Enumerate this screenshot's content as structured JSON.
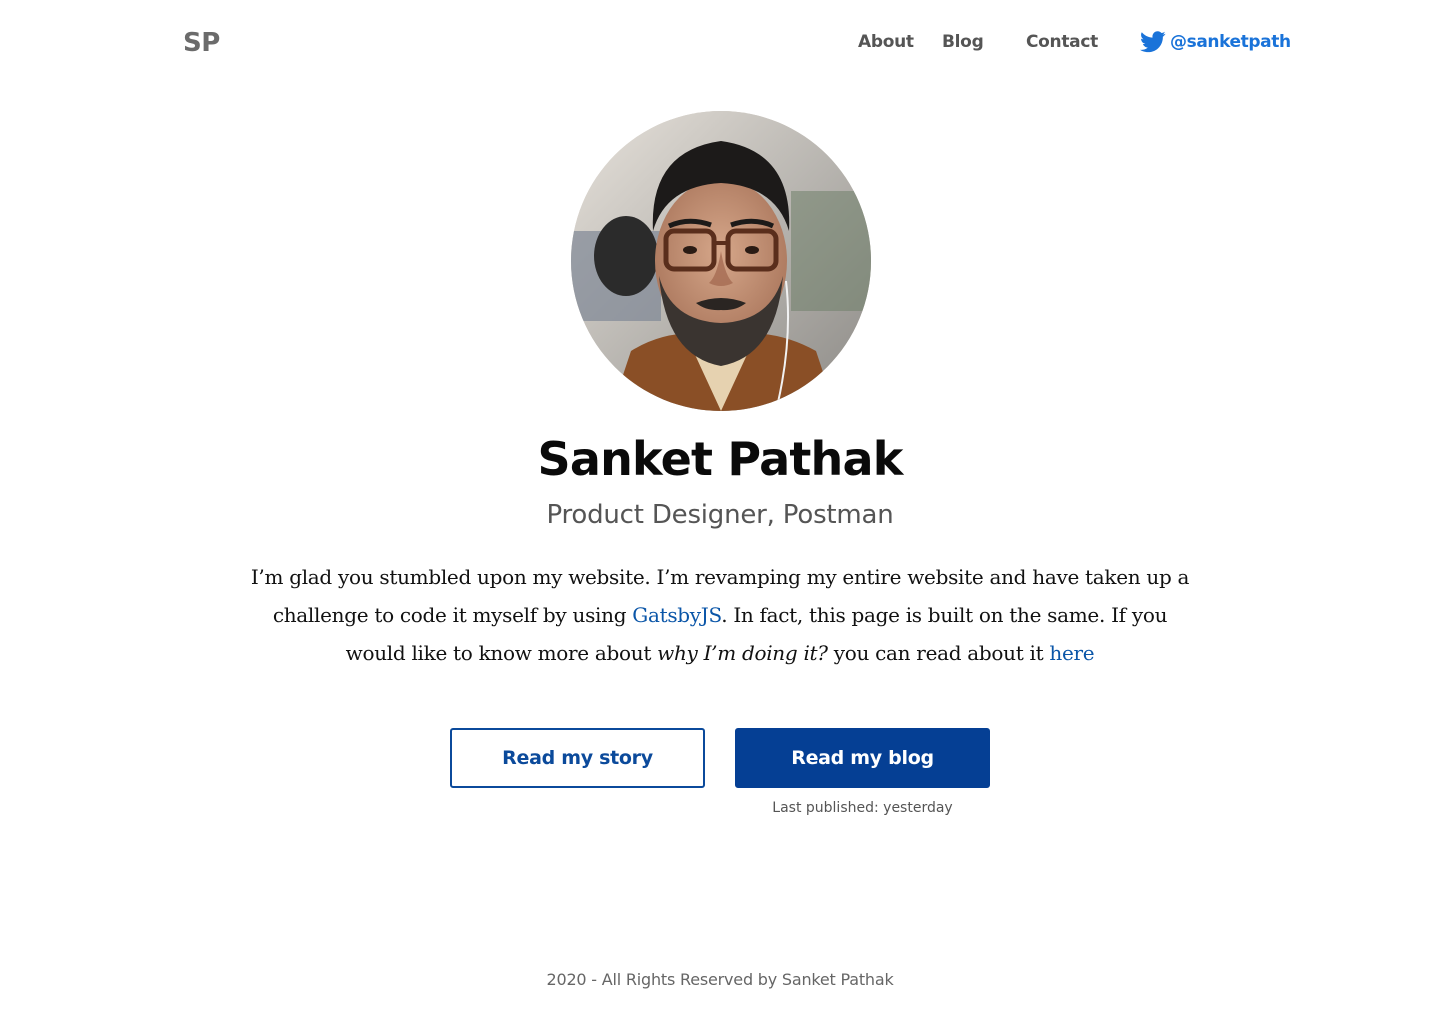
{
  "header": {
    "logo": "SP",
    "nav": [
      {
        "label": "About"
      },
      {
        "label": "Blog"
      },
      {
        "label": "Contact"
      }
    ],
    "twitter": {
      "icon": "twitter-icon",
      "handle": "@sanketpath",
      "color": "#1a73d9"
    }
  },
  "profile": {
    "name": "Sanket Pathak",
    "role": "Product Designer, Postman"
  },
  "intro": {
    "part1": "I’m glad you stumbled upon my website. I’m revamping my entire website and have taken up a challenge to code it myself by using ",
    "link1": "GatsbyJS",
    "part2": ". In fact, this page is built on the same. If you would like to know more about ",
    "emphasis": "why I’m doing it?",
    "part3": " you can read about it ",
    "link2": "here"
  },
  "actions": {
    "story_label": "Read my story",
    "blog_label": "Read my blog",
    "last_published": "Last published: yesterday"
  },
  "footer": {
    "text": "2020  - All Rights Reserved by Sanket Pathak"
  },
  "colors": {
    "primary": "#053f94",
    "link": "#0b56a8",
    "muted": "#555555"
  }
}
